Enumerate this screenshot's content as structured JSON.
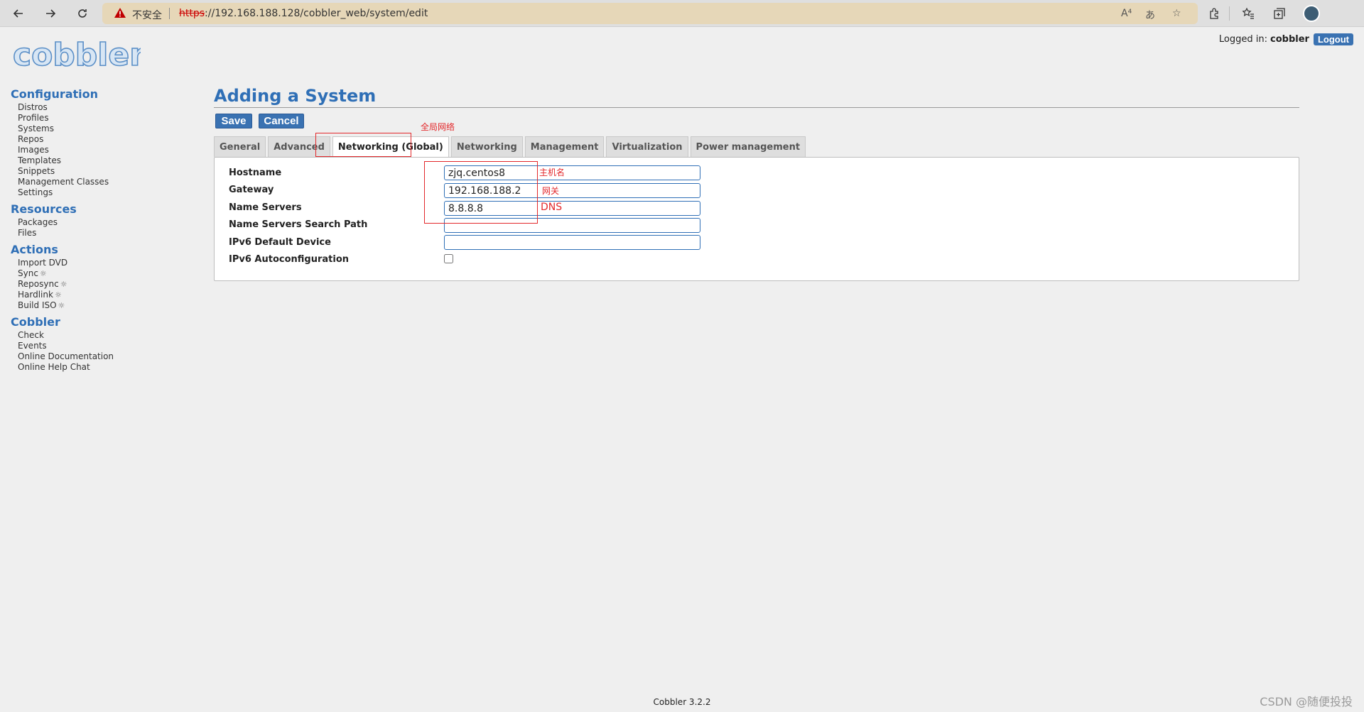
{
  "browser": {
    "security_label": "不安全",
    "url_protocol": "https",
    "url_rest": "://192.168.188.128/cobbler_web/system/edit",
    "warning_color": "#c00000"
  },
  "app": {
    "logo_text": "cobbler",
    "logged_in_label": "Logged in:",
    "logged_in_user": "cobbler",
    "logout_label": "Logout"
  },
  "sidebar": {
    "sections": [
      {
        "title": "Configuration",
        "items": [
          "Distros",
          "Profiles",
          "Systems",
          "Repos",
          "Images",
          "Templates",
          "Snippets",
          "Management Classes",
          "Settings"
        ]
      },
      {
        "title": "Resources",
        "items": [
          "Packages",
          "Files"
        ]
      },
      {
        "title": "Actions",
        "items": [
          "Import DVD",
          "Sync",
          "Reposync",
          "Hardlink",
          "Build ISO"
        ]
      },
      {
        "title": "Cobbler",
        "items": [
          "Check",
          "Events",
          "Online Documentation",
          "Online Help Chat"
        ]
      }
    ]
  },
  "main": {
    "title": "Adding a System",
    "save_label": "Save",
    "cancel_label": "Cancel",
    "tabs": [
      "General",
      "Advanced",
      "Networking (Global)",
      "Networking",
      "Management",
      "Virtualization",
      "Power management"
    ],
    "active_tab": "Networking (Global)",
    "fields": {
      "hostname": {
        "label": "Hostname",
        "value": "zjq.centos8"
      },
      "gateway": {
        "label": "Gateway",
        "value": "192.168.188.2"
      },
      "name_servers": {
        "label": "Name Servers",
        "value": "8.8.8.8"
      },
      "name_servers_search": {
        "label": "Name Servers Search Path",
        "value": ""
      },
      "ipv6_default_device": {
        "label": "IPv6 Default Device",
        "value": ""
      },
      "ipv6_autoconfig": {
        "label": "IPv6 Autoconfiguration",
        "checked": false
      }
    }
  },
  "annotations": {
    "tab_note": "全局网络",
    "hostname_note": "主机名",
    "gateway_note": "网关",
    "dns_note": "DNS",
    "color": "#e3282b"
  },
  "footer": {
    "version": "Cobbler 3.2.2"
  },
  "watermark": "CSDN @随便投投",
  "colors": {
    "accent": "#2f6fb6",
    "button": "#3a72b2"
  }
}
